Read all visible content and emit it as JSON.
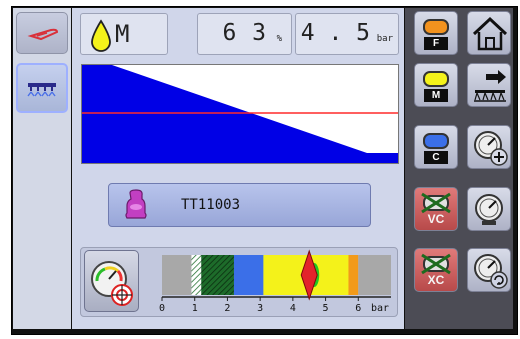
{
  "status": {
    "product": "M",
    "percent": "6 3",
    "percent_unit": "%",
    "pressure": "4 . 5",
    "pressure_unit": "bar"
  },
  "nozzle": {
    "label": "TT11003"
  },
  "pressure_scale": {
    "ticks": [
      "0",
      "1",
      "2",
      "3",
      "4",
      "5",
      "6"
    ],
    "unit": "bar",
    "value": 4.5,
    "range": [
      0,
      7
    ],
    "bands": [
      {
        "from": 0,
        "to": 0.9,
        "color": "#a8a8a8",
        "name": "gray"
      },
      {
        "from": 0.9,
        "to": 1.2,
        "color": "#ffffff",
        "name": "striped-light"
      },
      {
        "from": 1.2,
        "to": 2.2,
        "color": "#1d6b2a",
        "name": "striped-dark-green"
      },
      {
        "from": 2.2,
        "to": 3.1,
        "color": "#3b6fe8",
        "name": "blue"
      },
      {
        "from": 3.1,
        "to": 5.7,
        "color": "#f4f21a",
        "name": "yellow"
      },
      {
        "from": 5.7,
        "to": 6.0,
        "color": "#f29a1a",
        "name": "orange"
      },
      {
        "from": 6.0,
        "to": 7.0,
        "color": "#a8a8a8",
        "name": "gray"
      }
    ]
  },
  "right_panel": {
    "droplet_buttons": [
      {
        "tag": "F",
        "color": "#f2921e"
      },
      {
        "tag": "M",
        "color": "#f4f21a"
      },
      {
        "tag": "C",
        "color": "#3b6fe8"
      },
      {
        "tag": "VC",
        "color": "#e0e0e0",
        "crossed": true
      },
      {
        "tag": "XC",
        "color": "#e0e0e0",
        "crossed": true
      }
    ]
  },
  "colors": {
    "accent_blue": "#0000e6",
    "reference_line": "#ff2a2a",
    "pointer": "#e3242b",
    "green_pointer": "#22c81f"
  }
}
